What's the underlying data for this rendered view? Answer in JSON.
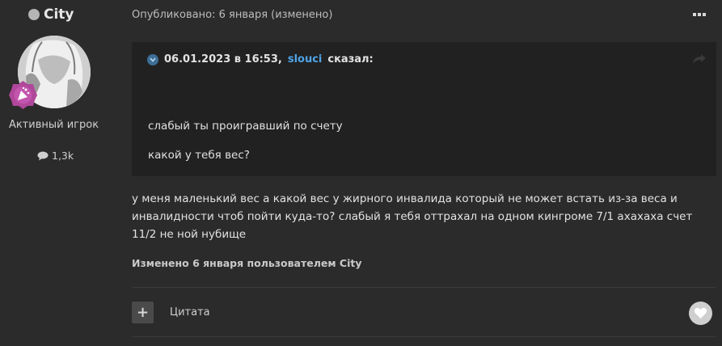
{
  "author": {
    "name": "City",
    "group": "Активный игрок",
    "post_count": "1,3k"
  },
  "post": {
    "published": "Опубликовано: 6 января (изменено)",
    "body": "у меня маленький вес а какой вес у жирного инвалида который не может встать из-за веса и инвалидности чтоб пойти куда-то? слабый я тебя оттрахал на одном кингроме 7/1 ахахаха счет 11/2 не ной нубище",
    "edited_note": "Изменено 6 января пользователем City"
  },
  "quote": {
    "date": "06.01.2023 в 16:53,",
    "user": "slouci",
    "said": "сказал:",
    "line1": "слабый ты проигравший по счету",
    "line2": "какой у тебя вес?"
  },
  "actions": {
    "plus_label": "+",
    "quote_label": "Цитата"
  },
  "icons": {
    "status": "status-dot-icon",
    "badge": "rank-badge-icon",
    "posts": "comment-icon",
    "more": "more-horizontal-icon",
    "quote_toggle": "chevron-down-icon",
    "share": "share-icon",
    "like": "heart-icon"
  },
  "colors": {
    "background": "#2b2b2b",
    "quote_background": "#212121",
    "link": "#4fa3e6",
    "badge": "#b0479a"
  }
}
